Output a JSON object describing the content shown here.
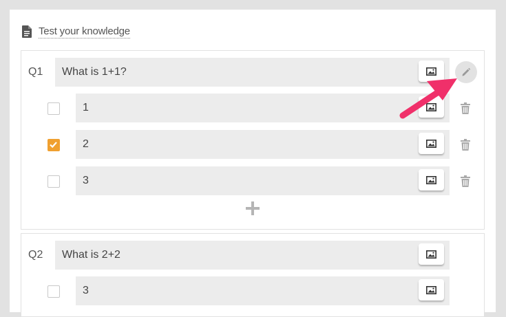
{
  "quiz": {
    "title": "Test your knowledge"
  },
  "questions": [
    {
      "number": "Q1",
      "text": "What is 1+1?",
      "answers": [
        {
          "text": "1",
          "checked": false
        },
        {
          "text": "2",
          "checked": true
        },
        {
          "text": "3",
          "checked": false
        }
      ]
    },
    {
      "number": "Q2",
      "text": "What is 2+2",
      "answers": [
        {
          "text": "3",
          "checked": false
        }
      ]
    }
  ],
  "icons": {
    "document": "document-icon",
    "image": "image-icon",
    "edit": "pencil-icon",
    "delete": "trash-icon",
    "add": "plus-icon",
    "check": "check-icon",
    "annotation": "arrow-annotation"
  },
  "colors": {
    "accent_checkbox": "#f0a030",
    "annotation_arrow": "#f0306a",
    "field_background": "#ececec"
  }
}
